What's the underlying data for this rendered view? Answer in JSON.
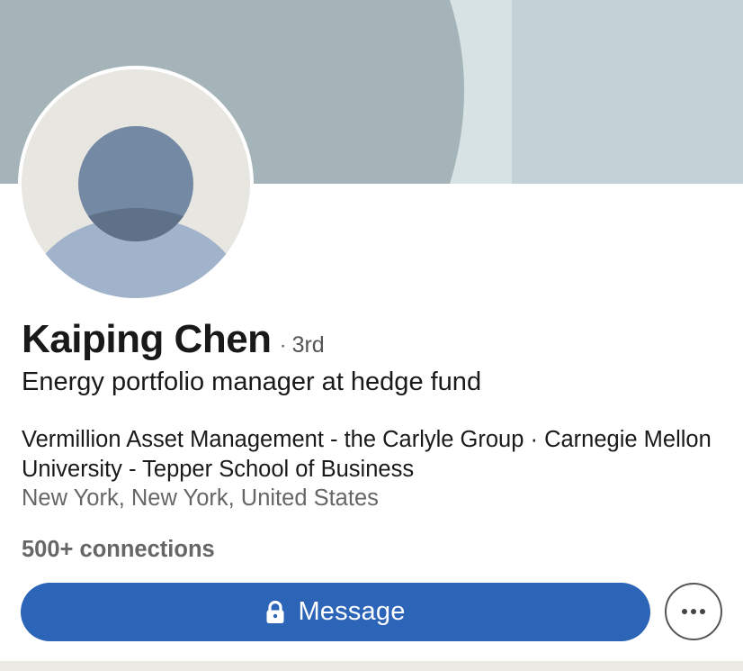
{
  "profile": {
    "name": "Kaiping Chen",
    "degree_separator": "·",
    "degree": "3rd",
    "headline": "Energy portfolio manager at hedge fund",
    "company_education": "Vermillion Asset Management - the Carlyle Group · Carnegie Mellon University - Tepper School of Business",
    "location": "New York, New York, United States",
    "connections": "500+ connections"
  },
  "actions": {
    "message_label": "Message",
    "message_icon": "lock-icon",
    "more_icon": "more-horizontal-icon"
  },
  "colors": {
    "primary_button": "#2c64b8",
    "banner_dark": "#a4b4b8",
    "banner_light": "#c2d2d6",
    "banner_mid": "#d6e2e3",
    "avatar_bg": "#e8e6e1",
    "avatar_head": "#7489a3",
    "avatar_body": "#a1b3cb"
  }
}
